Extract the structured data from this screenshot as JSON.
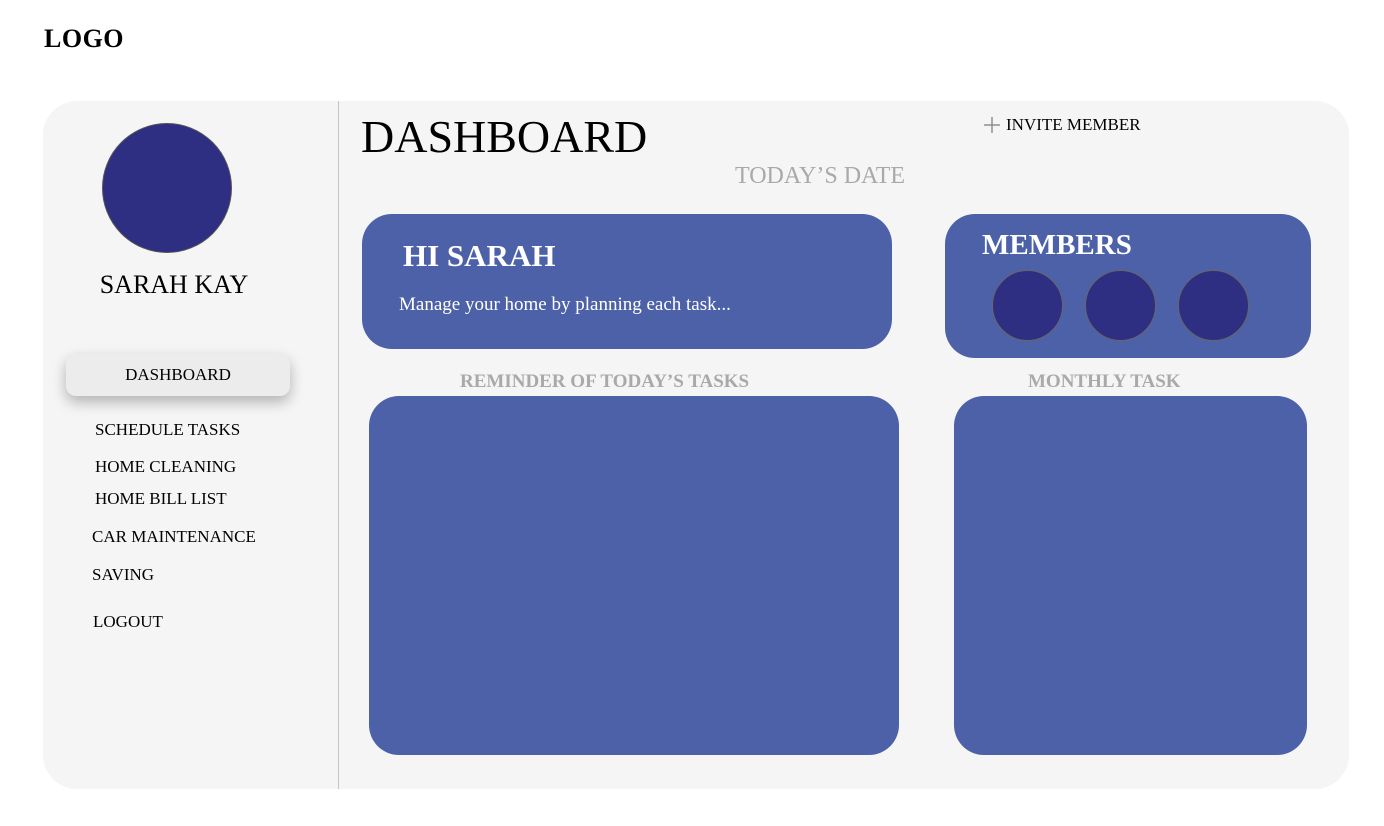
{
  "logo": "LOGO",
  "sidebar": {
    "user_name": "SARAH KAY",
    "active_item": "DASHBOARD",
    "items": [
      {
        "label": "SCHEDULE TASKS"
      },
      {
        "label": "HOME CLEANING"
      },
      {
        "label": "HOME BILL LIST"
      },
      {
        "label": "CAR MAINTENANCE"
      },
      {
        "label": "SAVING"
      },
      {
        "label": "LOGOUT"
      }
    ]
  },
  "header": {
    "title": "DASHBOARD",
    "invite_label": "INVITE MEMBER",
    "date_label": "TODAY’S DATE"
  },
  "greeting": {
    "title": "HI SARAH",
    "subtitle": "Manage your home by planning each task..."
  },
  "members": {
    "title": "MEMBERS"
  },
  "sections": {
    "reminder_label": "REMINDER OF TODAY’S TASKS",
    "monthly_label": "MONTHLY TASK"
  },
  "colors": {
    "panel": "#4c61a8",
    "avatar": "#2e2e82",
    "background": "#f5f5f5",
    "muted_text": "#a9a9a9"
  },
  "icons": {
    "invite": "plus-icon"
  }
}
